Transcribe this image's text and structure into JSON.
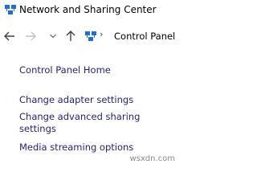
{
  "window": {
    "title": "Network and Sharing Center"
  },
  "navbar": {
    "back_icon": "back-arrow",
    "forward_icon": "forward-arrow",
    "recent_icon": "chevron-down",
    "up_icon": "up-arrow",
    "breadcrumb_icon": "network-icon",
    "breadcrumb_separator": "›",
    "breadcrumb_label": "Control Panel"
  },
  "sidebar": {
    "items": [
      {
        "label": "Control Panel Home"
      },
      {
        "label": "Change adapter settings"
      },
      {
        "label": "Change advanced sharing"
      },
      {
        "label": "settings"
      },
      {
        "label": "Media streaming options"
      }
    ]
  },
  "watermark": {
    "text": "wsxdn.com"
  },
  "colors": {
    "link": "#1f1f7a",
    "text": "#000000",
    "background": "#ffffff"
  }
}
